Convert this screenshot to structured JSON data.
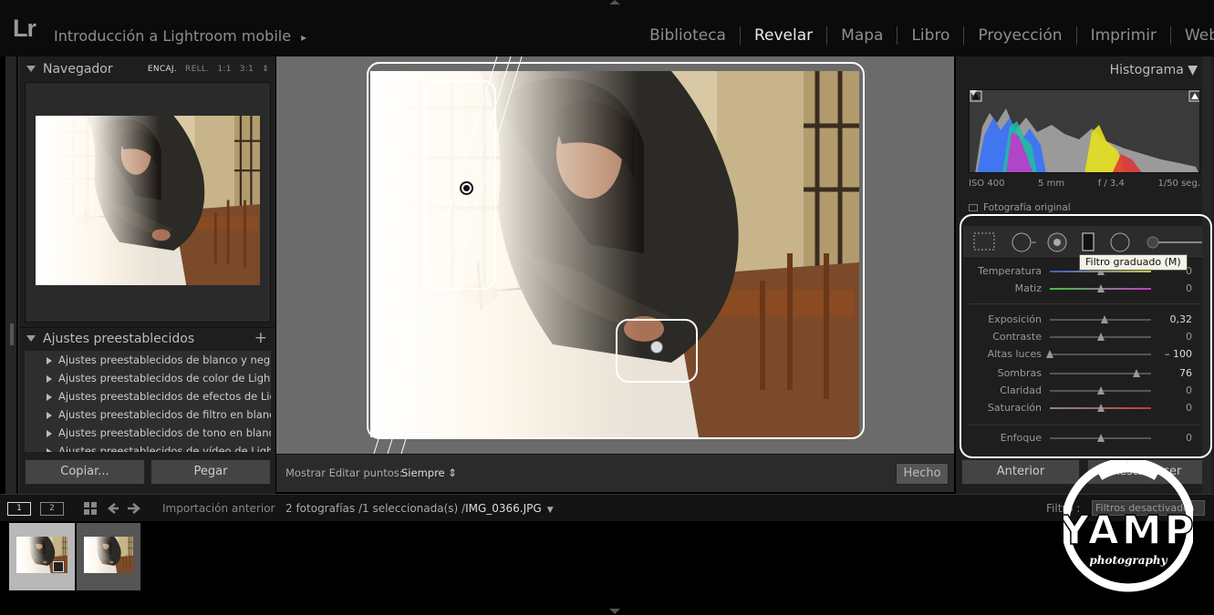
{
  "app": {
    "logo": "Lr",
    "catalog_title": "Introducción a Lightroom mobile",
    "catalog_arrow": "▸",
    "modules": [
      {
        "label": "Biblioteca",
        "active": false
      },
      {
        "label": "Revelar",
        "active": true
      },
      {
        "label": "Mapa",
        "active": false
      },
      {
        "label": "Libro",
        "active": false
      },
      {
        "label": "Proyección",
        "active": false
      },
      {
        "label": "Imprimir",
        "active": false
      },
      {
        "label": "Web",
        "active": false
      }
    ]
  },
  "navigator": {
    "title": "Navegador",
    "options": [
      "ENCAJ.",
      "RELL.",
      "1:1",
      "3:1"
    ],
    "selected_option": "ENCAJ.",
    "stepper": "⇕"
  },
  "presets": {
    "title": "Ajustes preestablecidos",
    "add": "+",
    "items": [
      "Ajustes preestablecidos de blanco y negro...",
      "Ajustes preestablecidos de color de Lightr...",
      "Ajustes preestablecidos de efectos de Lig...",
      "Ajustes preestablecidos de filtro en blanco...",
      "Ajustes preestablecidos de tono en blanc...",
      "Ajustes preestablecidos de vídeo de Lightr..."
    ]
  },
  "left_buttons": {
    "copy": "Copiar...",
    "paste": "Pegar"
  },
  "toolbar": {
    "show_edit_points_label": "Mostrar Editar puntos:",
    "show_edit_points_value": "Siempre ⇕",
    "done": "Hecho"
  },
  "histogram": {
    "title": "Histograma ▼",
    "exif": {
      "iso": "ISO 400",
      "focal": "5 mm",
      "aperture": "f / 3,4",
      "shutter": "1/50 seg."
    },
    "original_photo": "Fotografía original"
  },
  "tooltip": "Filtro graduado (M)",
  "sliders": [
    {
      "label": "Temperatura",
      "value": "0",
      "pos": 0.5,
      "colors": [
        "#3a5ac8",
        "#c8c83a"
      ]
    },
    {
      "label": "Matiz",
      "value": "0",
      "pos": 0.5,
      "colors": [
        "#3ac83a",
        "#c83ac8"
      ]
    },
    {
      "label": "Exposición",
      "value": "0,32",
      "pos": 0.54,
      "hot": true
    },
    {
      "label": "Contraste",
      "value": "0",
      "pos": 0.5
    },
    {
      "label": "Altas luces",
      "value": "– 100",
      "pos": 0.0,
      "hot": true
    },
    {
      "label": "Sombras",
      "value": "76",
      "pos": 0.86,
      "hot": true
    },
    {
      "label": "Claridad",
      "value": "0",
      "pos": 0.5
    },
    {
      "label": "Saturación",
      "value": "0",
      "pos": 0.5,
      "colors": [
        "#888888",
        "#c83a3a"
      ]
    },
    {
      "label": "Enfoque",
      "value": "0",
      "pos": 0.5
    }
  ],
  "right_buttons": {
    "previous": "Anterior",
    "reset": "Restablecer"
  },
  "filmbar": {
    "screen1": "1",
    "screen2": "2",
    "import": "Importación anterior",
    "count": "2 fotografías /1 seleccionada(s) /",
    "filename": "IMG_0366.JPG",
    "filter_label": "Filtro :",
    "filter_value": "Filtros desactivados"
  },
  "watermark": {
    "brand": "YAMP",
    "sub": "photography"
  }
}
